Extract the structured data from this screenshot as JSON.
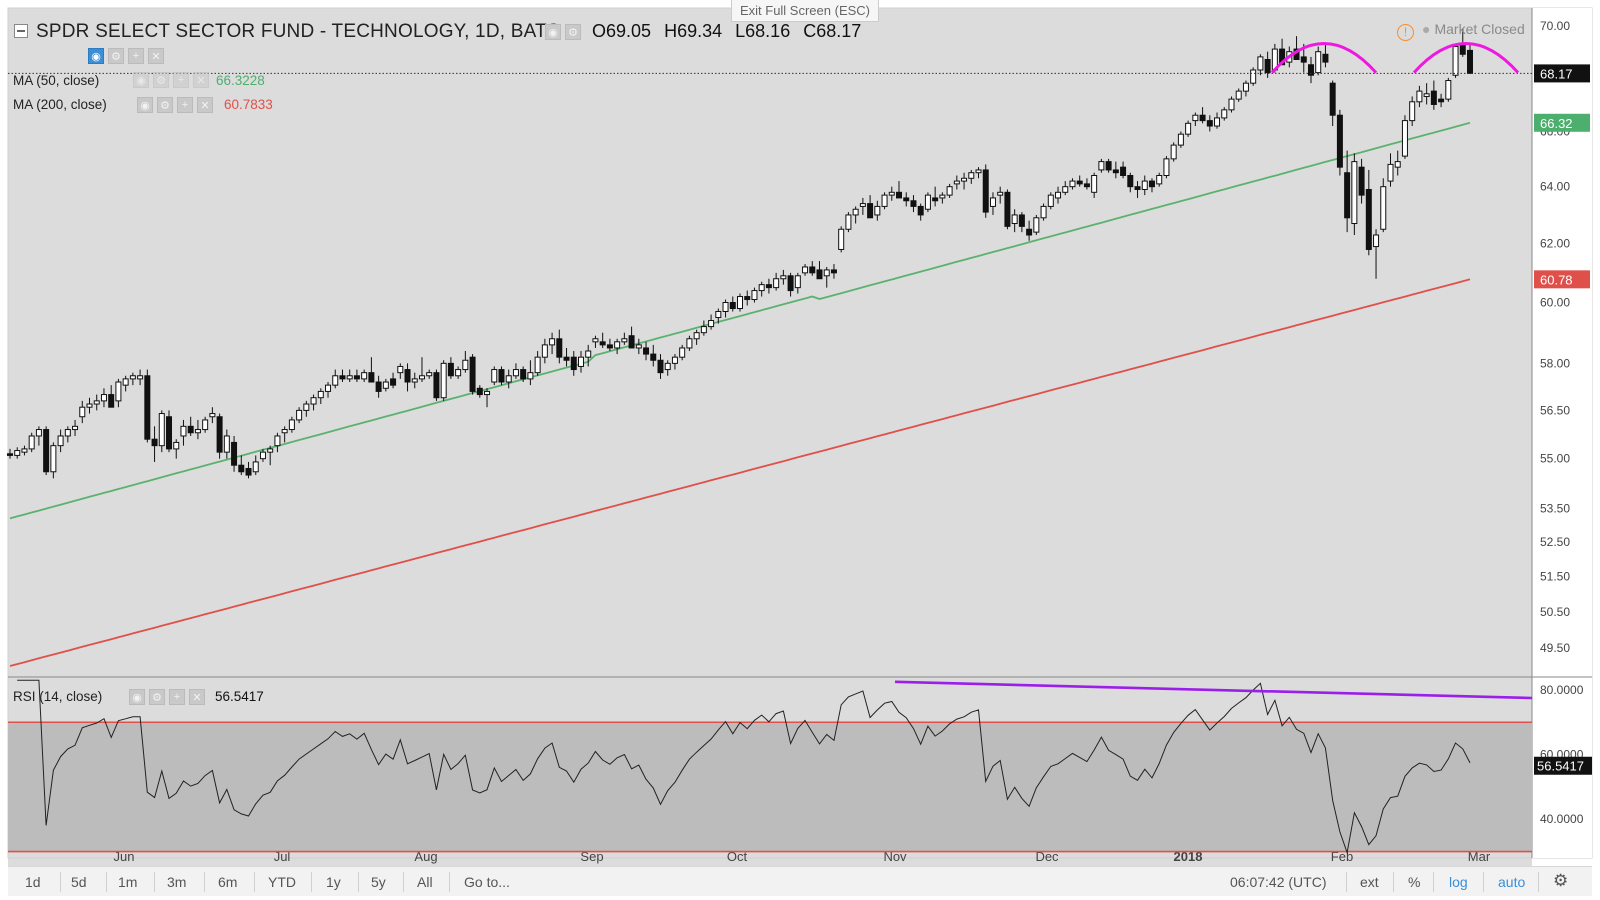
{
  "header": {
    "exit_fullscreen": "Exit Full Screen (ESC)",
    "title": "SPDR SELECT SECTOR FUND - TECHNOLOGY, 1D, BATS",
    "ohlc": {
      "o_label": "O",
      "o": "69.05",
      "h_label": "H",
      "h": "69.34",
      "l_label": "L",
      "l": "68.16",
      "c_label": "C",
      "c": "68.17"
    },
    "market_status": "Market Closed"
  },
  "indicators": {
    "ma50": {
      "label": "MA (50, close)",
      "value": "66.3228",
      "color": "#4caf6e"
    },
    "ma200": {
      "label": "MA (200, close)",
      "value": "60.7833",
      "color": "#e0504a"
    },
    "rsi": {
      "label": "RSI (14, close)",
      "value": "56.5417"
    }
  },
  "bottom_bar": {
    "timeframes": [
      "1d",
      "5d",
      "1m",
      "3m",
      "6m",
      "YTD",
      "1y",
      "5y",
      "All"
    ],
    "goto": "Go to...",
    "clock": "06:07:42 (UTC)",
    "ext": "ext",
    "percent": "%",
    "log": "log",
    "auto": "auto"
  },
  "chart_data": {
    "type": "candlestick",
    "title": "SPDR SELECT SECTOR FUND - TECHNOLOGY, 1D, BATS",
    "y_scale": "log",
    "y_ticks": [
      "70.00",
      "68.00",
      "66.00",
      "64.00",
      "62.00",
      "60.00",
      "58.00",
      "56.50",
      "55.00",
      "53.50",
      "52.50",
      "51.50",
      "50.50",
      "49.50"
    ],
    "ylim": [
      48.7,
      70.7
    ],
    "x_ticks": [
      "Jun",
      "Jul",
      "Aug",
      "Sep",
      "Oct",
      "Nov",
      "Dec",
      "2018",
      "Feb",
      "Mar"
    ],
    "start_date": "2017-05-10",
    "candles": [
      [
        55.15,
        55.3,
        55.0,
        55.1
      ],
      [
        55.1,
        55.35,
        55.0,
        55.25
      ],
      [
        55.2,
        55.4,
        55.1,
        55.3
      ],
      [
        55.3,
        55.8,
        55.2,
        55.7
      ],
      [
        55.7,
        56.0,
        55.4,
        55.9
      ],
      [
        55.9,
        56.0,
        54.5,
        54.6
      ],
      [
        54.6,
        55.5,
        54.4,
        55.4
      ],
      [
        55.4,
        55.9,
        55.2,
        55.7
      ],
      [
        55.7,
        56.0,
        55.5,
        55.9
      ],
      [
        55.9,
        56.2,
        55.7,
        56.0
      ],
      [
        56.3,
        56.8,
        56.1,
        56.6
      ],
      [
        56.6,
        56.9,
        56.4,
        56.7
      ],
      [
        56.7,
        57.0,
        56.5,
        56.8
      ],
      [
        56.8,
        57.2,
        56.6,
        57.0
      ],
      [
        57.0,
        57.3,
        56.8,
        56.6
      ],
      [
        56.8,
        57.5,
        56.6,
        57.4
      ],
      [
        57.3,
        57.6,
        57.1,
        57.5
      ],
      [
        57.5,
        57.7,
        57.3,
        57.6
      ],
      [
        57.5,
        57.8,
        57.3,
        57.6
      ],
      [
        57.6,
        57.8,
        55.5,
        55.6
      ],
      [
        55.6,
        56.0,
        54.9,
        55.4
      ],
      [
        55.4,
        56.5,
        55.2,
        56.4
      ],
      [
        56.3,
        56.5,
        55.2,
        55.3
      ],
      [
        55.3,
        55.6,
        55.0,
        55.5
      ],
      [
        55.7,
        56.2,
        55.4,
        56.0
      ],
      [
        56.0,
        56.3,
        55.7,
        55.8
      ],
      [
        55.8,
        56.2,
        55.6,
        55.9
      ],
      [
        55.9,
        56.3,
        55.8,
        56.2
      ],
      [
        56.3,
        56.6,
        56.1,
        56.4
      ],
      [
        56.3,
        56.4,
        55.0,
        55.2
      ],
      [
        55.2,
        55.9,
        55.0,
        55.7
      ],
      [
        55.5,
        55.7,
        54.6,
        54.8
      ],
      [
        54.8,
        55.1,
        54.5,
        54.6
      ],
      [
        54.7,
        54.9,
        54.4,
        54.5
      ],
      [
        54.6,
        55.1,
        54.5,
        54.9
      ],
      [
        55.0,
        55.3,
        54.9,
        55.2
      ],
      [
        55.2,
        55.4,
        54.8,
        55.3
      ],
      [
        55.4,
        55.8,
        55.2,
        55.7
      ],
      [
        55.8,
        56.0,
        55.5,
        55.9
      ],
      [
        55.9,
        56.3,
        55.8,
        56.2
      ],
      [
        56.2,
        56.6,
        56.1,
        56.5
      ],
      [
        56.5,
        56.8,
        56.3,
        56.7
      ],
      [
        56.7,
        57.0,
        56.5,
        56.9
      ],
      [
        56.9,
        57.2,
        56.7,
        57.1
      ],
      [
        57.1,
        57.4,
        56.9,
        57.3
      ],
      [
        57.3,
        57.8,
        57.2,
        57.6
      ],
      [
        57.6,
        57.8,
        57.4,
        57.5
      ],
      [
        57.5,
        57.8,
        57.4,
        57.6
      ],
      [
        57.6,
        57.8,
        57.4,
        57.5
      ],
      [
        57.5,
        57.8,
        57.4,
        57.7
      ],
      [
        57.7,
        58.2,
        57.5,
        57.4
      ],
      [
        57.4,
        57.6,
        56.9,
        57.1
      ],
      [
        57.2,
        57.5,
        57.1,
        57.4
      ],
      [
        57.5,
        57.7,
        57.2,
        57.3
      ],
      [
        57.7,
        58.0,
        57.5,
        57.9
      ],
      [
        57.8,
        58.0,
        57.1,
        57.4
      ],
      [
        57.4,
        57.7,
        57.2,
        57.5
      ],
      [
        57.5,
        58.2,
        57.4,
        57.6
      ],
      [
        57.6,
        57.8,
        57.5,
        57.7
      ],
      [
        57.7,
        57.8,
        56.8,
        56.9
      ],
      [
        56.9,
        58.1,
        56.8,
        58.0
      ],
      [
        58.0,
        58.2,
        57.5,
        57.6
      ],
      [
        57.6,
        57.9,
        57.5,
        57.8
      ],
      [
        57.8,
        58.4,
        57.7,
        58.1
      ],
      [
        58.2,
        58.3,
        57.0,
        57.1
      ],
      [
        57.2,
        57.3,
        56.9,
        57.0
      ],
      [
        57.0,
        57.2,
        56.6,
        57.1
      ],
      [
        57.4,
        57.9,
        57.3,
        57.8
      ],
      [
        57.8,
        57.9,
        57.3,
        57.4
      ],
      [
        57.4,
        57.8,
        57.2,
        57.6
      ],
      [
        57.6,
        58.0,
        57.5,
        57.8
      ],
      [
        57.8,
        57.9,
        57.4,
        57.5
      ],
      [
        57.5,
        58.1,
        57.3,
        57.7
      ],
      [
        57.7,
        58.4,
        57.6,
        58.2
      ],
      [
        58.2,
        58.8,
        58.0,
        58.6
      ],
      [
        58.6,
        59.0,
        58.3,
        58.8
      ],
      [
        58.8,
        59.1,
        58.0,
        58.2
      ],
      [
        58.2,
        58.5,
        57.9,
        58.1
      ],
      [
        58.2,
        58.4,
        57.6,
        57.8
      ],
      [
        57.9,
        58.4,
        57.7,
        58.2
      ],
      [
        58.2,
        58.6,
        57.9,
        58.4
      ],
      [
        58.7,
        58.9,
        58.5,
        58.8
      ],
      [
        58.7,
        59.0,
        58.5,
        58.6
      ],
      [
        58.6,
        58.8,
        58.4,
        58.5
      ],
      [
        58.5,
        58.8,
        58.3,
        58.7
      ],
      [
        58.7,
        59.0,
        58.6,
        58.8
      ],
      [
        58.9,
        59.2,
        58.7,
        58.5
      ],
      [
        58.5,
        58.8,
        58.3,
        58.6
      ],
      [
        58.5,
        58.7,
        58.1,
        58.3
      ],
      [
        58.3,
        58.6,
        57.9,
        58.1
      ],
      [
        58.1,
        58.3,
        57.5,
        57.7
      ],
      [
        57.8,
        58.1,
        57.6,
        58.0
      ],
      [
        58.0,
        58.3,
        57.8,
        58.2
      ],
      [
        58.2,
        58.6,
        58.1,
        58.5
      ],
      [
        58.5,
        58.9,
        58.4,
        58.8
      ],
      [
        58.8,
        59.1,
        58.6,
        59.0
      ],
      [
        59.0,
        59.4,
        58.9,
        59.2
      ],
      [
        59.2,
        59.6,
        59.1,
        59.4
      ],
      [
        59.5,
        59.8,
        59.3,
        59.7
      ],
      [
        59.7,
        60.1,
        59.5,
        60.0
      ],
      [
        60.0,
        60.2,
        59.7,
        59.8
      ],
      [
        59.8,
        60.3,
        59.7,
        60.2
      ],
      [
        60.2,
        60.4,
        59.9,
        60.1
      ],
      [
        60.1,
        60.5,
        60.0,
        60.4
      ],
      [
        60.4,
        60.7,
        60.2,
        60.6
      ],
      [
        60.6,
        60.8,
        60.3,
        60.5
      ],
      [
        60.5,
        61.0,
        60.4,
        60.8
      ],
      [
        60.8,
        61.1,
        60.6,
        60.9
      ],
      [
        60.9,
        61.0,
        60.2,
        60.4
      ],
      [
        60.5,
        61.0,
        60.3,
        60.9
      ],
      [
        61.0,
        61.3,
        60.9,
        61.2
      ],
      [
        61.2,
        61.4,
        60.9,
        61.0
      ],
      [
        61.1,
        61.4,
        60.8,
        60.8
      ],
      [
        60.9,
        61.2,
        60.5,
        61.1
      ],
      [
        61.1,
        61.3,
        60.8,
        61.0
      ],
      [
        61.8,
        62.6,
        61.7,
        62.5
      ],
      [
        62.5,
        63.1,
        62.4,
        63.0
      ],
      [
        63.0,
        63.3,
        62.7,
        63.2
      ],
      [
        63.3,
        63.6,
        63.0,
        63.4
      ],
      [
        63.4,
        63.7,
        63.1,
        62.9
      ],
      [
        63.0,
        63.5,
        62.8,
        63.3
      ],
      [
        63.3,
        63.8,
        63.2,
        63.7
      ],
      [
        63.7,
        64.0,
        63.5,
        63.8
      ],
      [
        63.8,
        64.2,
        63.6,
        63.6
      ],
      [
        63.6,
        63.8,
        63.3,
        63.5
      ],
      [
        63.5,
        63.7,
        63.1,
        63.3
      ],
      [
        63.3,
        63.4,
        62.8,
        63.0
      ],
      [
        63.2,
        63.8,
        63.1,
        63.7
      ],
      [
        63.6,
        64.0,
        63.3,
        63.5
      ],
      [
        63.6,
        63.8,
        63.4,
        63.7
      ],
      [
        63.7,
        64.1,
        63.6,
        64.0
      ],
      [
        64.1,
        64.4,
        63.9,
        64.2
      ],
      [
        64.2,
        64.5,
        63.9,
        64.3
      ],
      [
        64.3,
        64.6,
        64.1,
        64.5
      ],
      [
        64.5,
        64.7,
        64.3,
        64.6
      ],
      [
        64.6,
        64.8,
        62.9,
        63.1
      ],
      [
        63.3,
        63.8,
        63.0,
        63.6
      ],
      [
        63.7,
        64.0,
        63.4,
        63.8
      ],
      [
        63.8,
        63.9,
        62.5,
        62.6
      ],
      [
        62.7,
        63.2,
        62.4,
        63.0
      ],
      [
        63.0,
        63.1,
        62.4,
        62.6
      ],
      [
        62.5,
        62.8,
        62.1,
        62.3
      ],
      [
        62.4,
        63.0,
        62.3,
        62.9
      ],
      [
        62.9,
        63.4,
        62.8,
        63.3
      ],
      [
        63.3,
        63.8,
        63.2,
        63.7
      ],
      [
        63.6,
        64.0,
        63.4,
        63.8
      ],
      [
        63.8,
        64.2,
        63.7,
        64.0
      ],
      [
        64.0,
        64.3,
        63.9,
        64.2
      ],
      [
        64.2,
        64.4,
        64.0,
        64.1
      ],
      [
        64.1,
        64.3,
        63.9,
        64.0
      ],
      [
        63.8,
        64.5,
        63.6,
        64.4
      ],
      [
        64.6,
        65.0,
        64.5,
        64.9
      ],
      [
        64.9,
        65.0,
        64.5,
        64.6
      ],
      [
        64.6,
        64.9,
        64.3,
        64.5
      ],
      [
        64.7,
        64.9,
        64.3,
        64.4
      ],
      [
        64.4,
        64.5,
        63.8,
        64.0
      ],
      [
        64.0,
        64.2,
        63.6,
        63.9
      ],
      [
        63.9,
        64.4,
        63.7,
        64.2
      ],
      [
        64.2,
        64.3,
        63.8,
        64.0
      ],
      [
        64.1,
        64.5,
        64.0,
        64.4
      ],
      [
        64.4,
        65.1,
        64.3,
        65.0
      ],
      [
        65.0,
        65.6,
        64.9,
        65.5
      ],
      [
        65.5,
        66.0,
        65.4,
        65.9
      ],
      [
        65.9,
        66.4,
        65.8,
        66.3
      ],
      [
        66.4,
        66.7,
        66.2,
        66.6
      ],
      [
        66.6,
        66.9,
        66.3,
        66.4
      ],
      [
        66.4,
        66.6,
        66.0,
        66.2
      ],
      [
        66.2,
        66.7,
        66.1,
        66.5
      ],
      [
        66.5,
        66.9,
        66.4,
        66.8
      ],
      [
        66.8,
        67.3,
        66.7,
        67.2
      ],
      [
        67.2,
        67.6,
        67.1,
        67.5
      ],
      [
        67.5,
        67.9,
        67.3,
        67.8
      ],
      [
        67.8,
        68.4,
        67.7,
        68.3
      ],
      [
        68.3,
        68.9,
        68.1,
        68.8
      ],
      [
        68.7,
        69.0,
        68.0,
        68.2
      ],
      [
        68.3,
        69.3,
        68.2,
        69.1
      ],
      [
        69.1,
        69.5,
        68.5,
        68.5
      ],
      [
        68.6,
        69.2,
        68.4,
        69.0
      ],
      [
        69.1,
        69.6,
        68.7,
        68.7
      ],
      [
        68.8,
        69.3,
        68.2,
        68.6
      ],
      [
        68.5,
        68.8,
        67.8,
        68.1
      ],
      [
        68.2,
        69.2,
        68.1,
        69.0
      ],
      [
        68.9,
        69.3,
        68.4,
        68.6
      ],
      [
        67.8,
        67.9,
        66.2,
        66.6
      ],
      [
        66.6,
        66.8,
        64.4,
        64.7
      ],
      [
        64.5,
        65.3,
        62.4,
        62.9
      ],
      [
        62.7,
        65.2,
        62.3,
        64.9
      ],
      [
        64.7,
        65.0,
        63.4,
        63.7
      ],
      [
        63.9,
        64.6,
        61.6,
        61.8
      ],
      [
        61.9,
        62.5,
        60.8,
        62.3
      ],
      [
        62.5,
        64.3,
        62.4,
        64.0
      ],
      [
        64.2,
        65.2,
        64.0,
        64.8
      ],
      [
        64.7,
        65.3,
        64.4,
        64.9
      ],
      [
        65.1,
        66.6,
        65.0,
        66.4
      ],
      [
        66.4,
        67.3,
        66.2,
        67.1
      ],
      [
        67.1,
        67.7,
        66.9,
        67.5
      ],
      [
        67.3,
        67.8,
        67.0,
        67.4
      ],
      [
        67.5,
        67.9,
        66.8,
        67.0
      ],
      [
        67.2,
        67.4,
        66.9,
        67.1
      ],
      [
        67.2,
        68.0,
        67.1,
        67.9
      ],
      [
        68.1,
        69.3,
        68.0,
        69.2
      ],
      [
        69.3,
        69.9,
        68.8,
        68.9
      ],
      [
        69.05,
        69.34,
        68.16,
        68.17
      ]
    ],
    "ma50_start": 53.2,
    "ma50_end": 66.32,
    "ma200_start": 49.0,
    "ma200_end": 60.78,
    "last_price": "68.17",
    "ma50_label": "66.32",
    "ma200_label": "60.78",
    "rsi_panel": {
      "y_ticks": [
        "80.0000",
        "60.0000",
        "40.0000"
      ],
      "upper_band": 70,
      "lower_band": 30,
      "ylim": [
        28,
        84
      ],
      "last_value": "56.5417"
    },
    "annotations": {
      "magenta_arcs": 2,
      "purple_trendline": "RSI divergence"
    }
  }
}
